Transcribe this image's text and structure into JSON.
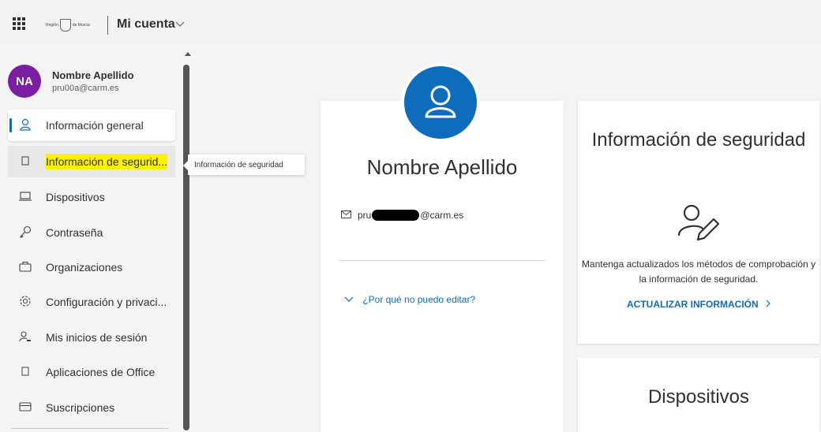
{
  "header": {
    "app_title": "Mi cuenta",
    "logo_text_left": "Región",
    "logo_text_right": "de Murcia"
  },
  "user": {
    "initials": "NA",
    "name": "Nombre Apellido",
    "email": "pru00a@carm.es"
  },
  "sidebar": {
    "items": [
      {
        "label": "Información general",
        "icon": "user-icon"
      },
      {
        "label": "Información de segurid...",
        "icon": "security-icon"
      },
      {
        "label": "Dispositivos",
        "icon": "laptop-icon"
      },
      {
        "label": "Contraseña",
        "icon": "key-icon"
      },
      {
        "label": "Organizaciones",
        "icon": "briefcase-icon"
      },
      {
        "label": "Configuración y privaci...",
        "icon": "gear-icon"
      },
      {
        "label": "Mis inicios de sesión",
        "icon": "user-key-icon"
      },
      {
        "label": "Aplicaciones de Office",
        "icon": "office-icon"
      },
      {
        "label": "Suscripciones",
        "icon": "card-icon"
      }
    ],
    "tooltip": "Información de seguridad"
  },
  "profile_card": {
    "name": "Nombre Apellido",
    "email_prefix": "pru",
    "email_suffix": "@carm.es",
    "why_link": "¿Por qué no puedo editar?"
  },
  "security_card": {
    "title": "Información de seguridad",
    "description": "Mantenga actualizados los métodos de comprobación y la información de seguridad.",
    "link": "ACTUALIZAR INFORMACIÓN"
  },
  "devices_card": {
    "title": "Dispositivos"
  },
  "colors": {
    "accent": "#0f6cbd",
    "avatar": "#7b1fa2",
    "highlight": "#fff200"
  }
}
